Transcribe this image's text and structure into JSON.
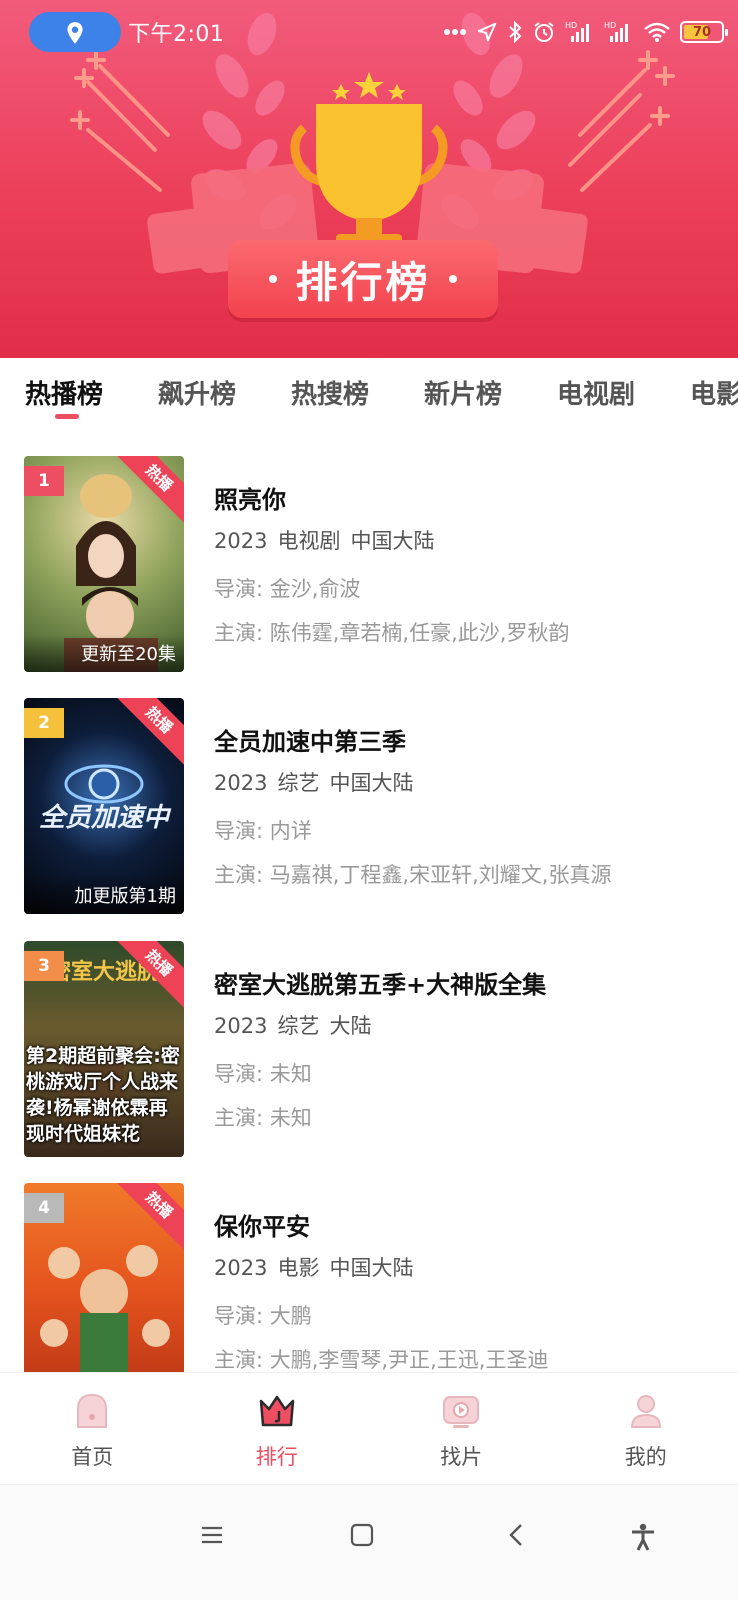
{
  "status_bar": {
    "time": "下午2:01",
    "battery_percent": "70",
    "battery_level": 0.7,
    "icons": [
      "location-icon",
      "more-dots-icon",
      "navigation-icon",
      "bluetooth-icon",
      "alarm-icon",
      "signal-hd-icon",
      "signal-hd-icon",
      "wifi-icon",
      "battery-icon"
    ]
  },
  "banner": {
    "title": "排行榜"
  },
  "tabs": [
    {
      "label": "热播榜",
      "active": true
    },
    {
      "label": "飙升榜",
      "active": false
    },
    {
      "label": "热搜榜",
      "active": false
    },
    {
      "label": "新片榜",
      "active": false
    },
    {
      "label": "电视剧",
      "active": false
    },
    {
      "label": "电影",
      "active": false
    }
  ],
  "items": [
    {
      "rank": "1",
      "rank_color": "#ee4e62",
      "tag": "热播",
      "poster_caption": "更新至20集",
      "title": "照亮你",
      "year": "2023",
      "genre": "电视剧",
      "region": "中国大陆",
      "director": "导演: 金沙,俞波",
      "cast": "主演: 陈伟霆,章若楠,任豪,此沙,罗秋韵"
    },
    {
      "rank": "2",
      "rank_color": "#f5c03a",
      "tag": "热播",
      "poster_caption": "加更版第1期",
      "poster_logo": "全员加速中",
      "title": "全员加速中第三季",
      "year": "2023",
      "genre": "综艺",
      "region": "中国大陆",
      "director": "导演: 内详",
      "cast": "主演: 马嘉祺,丁程鑫,宋亚轩,刘耀文,张真源"
    },
    {
      "rank": "3",
      "rank_color": "#f28e4a",
      "tag": "热播",
      "poster_caption": "第2期超前聚会:密桃游戏厅个人战来袭!杨幂谢依霖再现时代姐妹花",
      "poster_logo": "密室大逃脱",
      "title": "密室大逃脱第五季+大神版全集",
      "year": "2023",
      "genre": "综艺",
      "region": "大陆",
      "director": "导演: 未知",
      "cast": "主演: 未知"
    },
    {
      "rank": "4",
      "rank_color": "#b9b9b9",
      "tag": "热播",
      "poster_caption": "",
      "title": "保你平安",
      "year": "2023",
      "genre": "电影",
      "region": "中国大陆",
      "director": "导演: 大鹏",
      "cast": "主演: 大鹏,李雪琴,尹正,王迅,王圣迪"
    }
  ],
  "bottom_nav": [
    {
      "label": "首页",
      "icon": "home-icon",
      "active": false
    },
    {
      "label": "排行",
      "icon": "crown-icon",
      "active": true
    },
    {
      "label": "找片",
      "icon": "play-screen-icon",
      "active": false
    },
    {
      "label": "我的",
      "icon": "profile-icon",
      "active": false
    }
  ],
  "system_nav": [
    "menu-icon",
    "home-square-icon",
    "back-icon",
    "accessibility-icon"
  ],
  "colors": {
    "accent": "#ee4e62",
    "header_top": "#f25b7c",
    "header_bottom": "#e22e48",
    "trophy": "#f9c22e"
  }
}
